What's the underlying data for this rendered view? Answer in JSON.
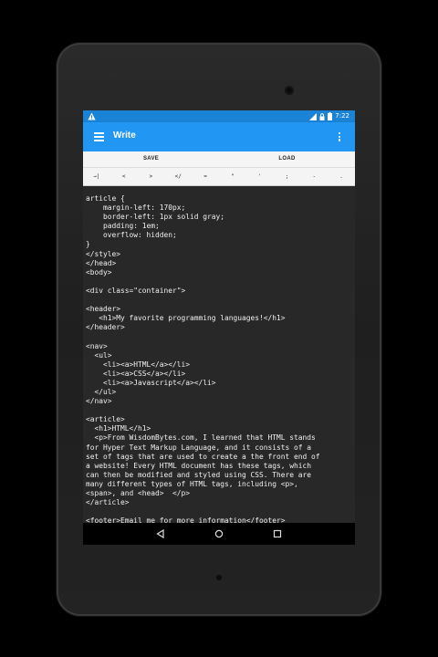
{
  "status": {
    "time": "7:22",
    "icons": [
      "warning-icon",
      "wifi-icon",
      "lock-icon",
      "battery-icon"
    ]
  },
  "appbar": {
    "title": "Write",
    "menu_icon": "hamburger-menu-icon",
    "overflow_icon": "more-vert-icon"
  },
  "actions": [
    {
      "label": "SAVE"
    },
    {
      "label": "LOAD"
    }
  ],
  "keys": [
    "→|",
    "<",
    ">",
    "</",
    "=",
    "\"",
    "'",
    ";",
    "-",
    "."
  ],
  "editor": {
    "content": "article {\n    margin-left: 170px;\n    border-left: 1px solid gray;\n    padding: 1em;\n    overflow: hidden;\n}\n</style>\n</head>\n<body>\n\n<div class=\"container\">\n\n<header>\n   <h1>My favorite programming languages!</h1>\n</header>\n\n<nav>\n  <ul>\n    <li><a>HTML</a></li>\n    <li><a>CSS</a></li>\n    <li><a>Javascript</a></li>\n  </ul>\n</nav>\n\n<article>\n  <h1>HTML</h1>\n  <p>From WisdomBytes.com, I learned that HTML stands\nfor Hyper Text Markup Language, and it consists of a\nset of tags that are used to create a the front end of\na website! Every HTML document has these tags, which\ncan then be modified and styled using CSS. There are\nmany different types of HTML tags, including <p>,\n<span>, and <head>  </p>\n</article>\n\n<footer>Email me for more information</footer>"
  },
  "navbar": [
    "back-icon",
    "home-icon",
    "recents-icon"
  ],
  "colors": {
    "statusbar": "#1a83d6",
    "appbar": "#2196f3",
    "editor_bg": "#282828",
    "editor_text": "#f0f0f0"
  }
}
